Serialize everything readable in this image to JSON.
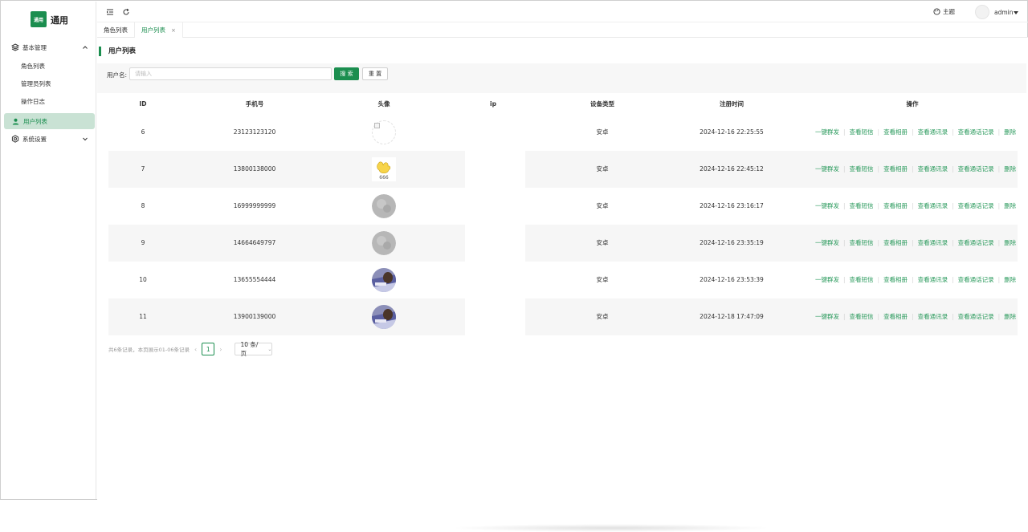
{
  "app": {
    "logo_text": "通用",
    "title": "通用"
  },
  "sidebar": {
    "groups": [
      {
        "label": "基本管理",
        "expanded": true
      },
      {
        "label": "系统设置",
        "expanded": false
      }
    ],
    "items": [
      {
        "label": "角色列表"
      },
      {
        "label": "管理员列表"
      },
      {
        "label": "操作日志"
      },
      {
        "label": "用户列表",
        "active": true
      }
    ]
  },
  "topbar": {
    "theme_label": "主题",
    "user_name": "admin"
  },
  "tabs": [
    {
      "label": "角色列表"
    },
    {
      "label": "用户列表",
      "active": true,
      "close": "×"
    }
  ],
  "page": {
    "title": "用户列表"
  },
  "filter": {
    "label": "用户名:",
    "placeholder": "请输入",
    "value": "",
    "search_label": "搜 索",
    "reset_label": "重 置"
  },
  "table": {
    "headers": {
      "id": "ID",
      "phone": "手机号",
      "avatar": "头像",
      "ip": "ip",
      "device": "设备类型",
      "time": "注册时间",
      "ops": "操作"
    },
    "actions": [
      "一键群发",
      "查看短信",
      "查看相册",
      "查看通讯录",
      "查看通话记录",
      "删除"
    ],
    "rows": [
      {
        "id": "6",
        "phone": "23123123120",
        "avatar": "broken-image",
        "ip": "",
        "device": "安卓",
        "time": "2024-12-16 22:25:55"
      },
      {
        "id": "7",
        "phone": "13800138000",
        "avatar": "cartoon-hand",
        "ip": "",
        "device": "安卓",
        "time": "2024-12-16 22:45:12"
      },
      {
        "id": "8",
        "phone": "16999999999",
        "avatar": "gray",
        "ip": "",
        "device": "安卓",
        "time": "2024-12-16 23:16:17"
      },
      {
        "id": "9",
        "phone": "14664649797",
        "avatar": "gray",
        "ip": "",
        "device": "安卓",
        "time": "2024-12-16 23:35:19"
      },
      {
        "id": "10",
        "phone": "13655554444",
        "avatar": "photo",
        "ip": "",
        "device": "安卓",
        "time": "2024-12-16 23:53:39"
      },
      {
        "id": "11",
        "phone": "13900139000",
        "avatar": "photo",
        "ip": "",
        "device": "安卓",
        "time": "2024-12-18 17:47:09"
      }
    ]
  },
  "pagination": {
    "total_text": "共6条记录，本页展示01-06条记录",
    "current_page": "1",
    "page_size": "10 条/页"
  },
  "colors": {
    "accent": "#1b8e4f",
    "link": "#2a9a5c",
    "active_bg": "#c9e2d4"
  }
}
